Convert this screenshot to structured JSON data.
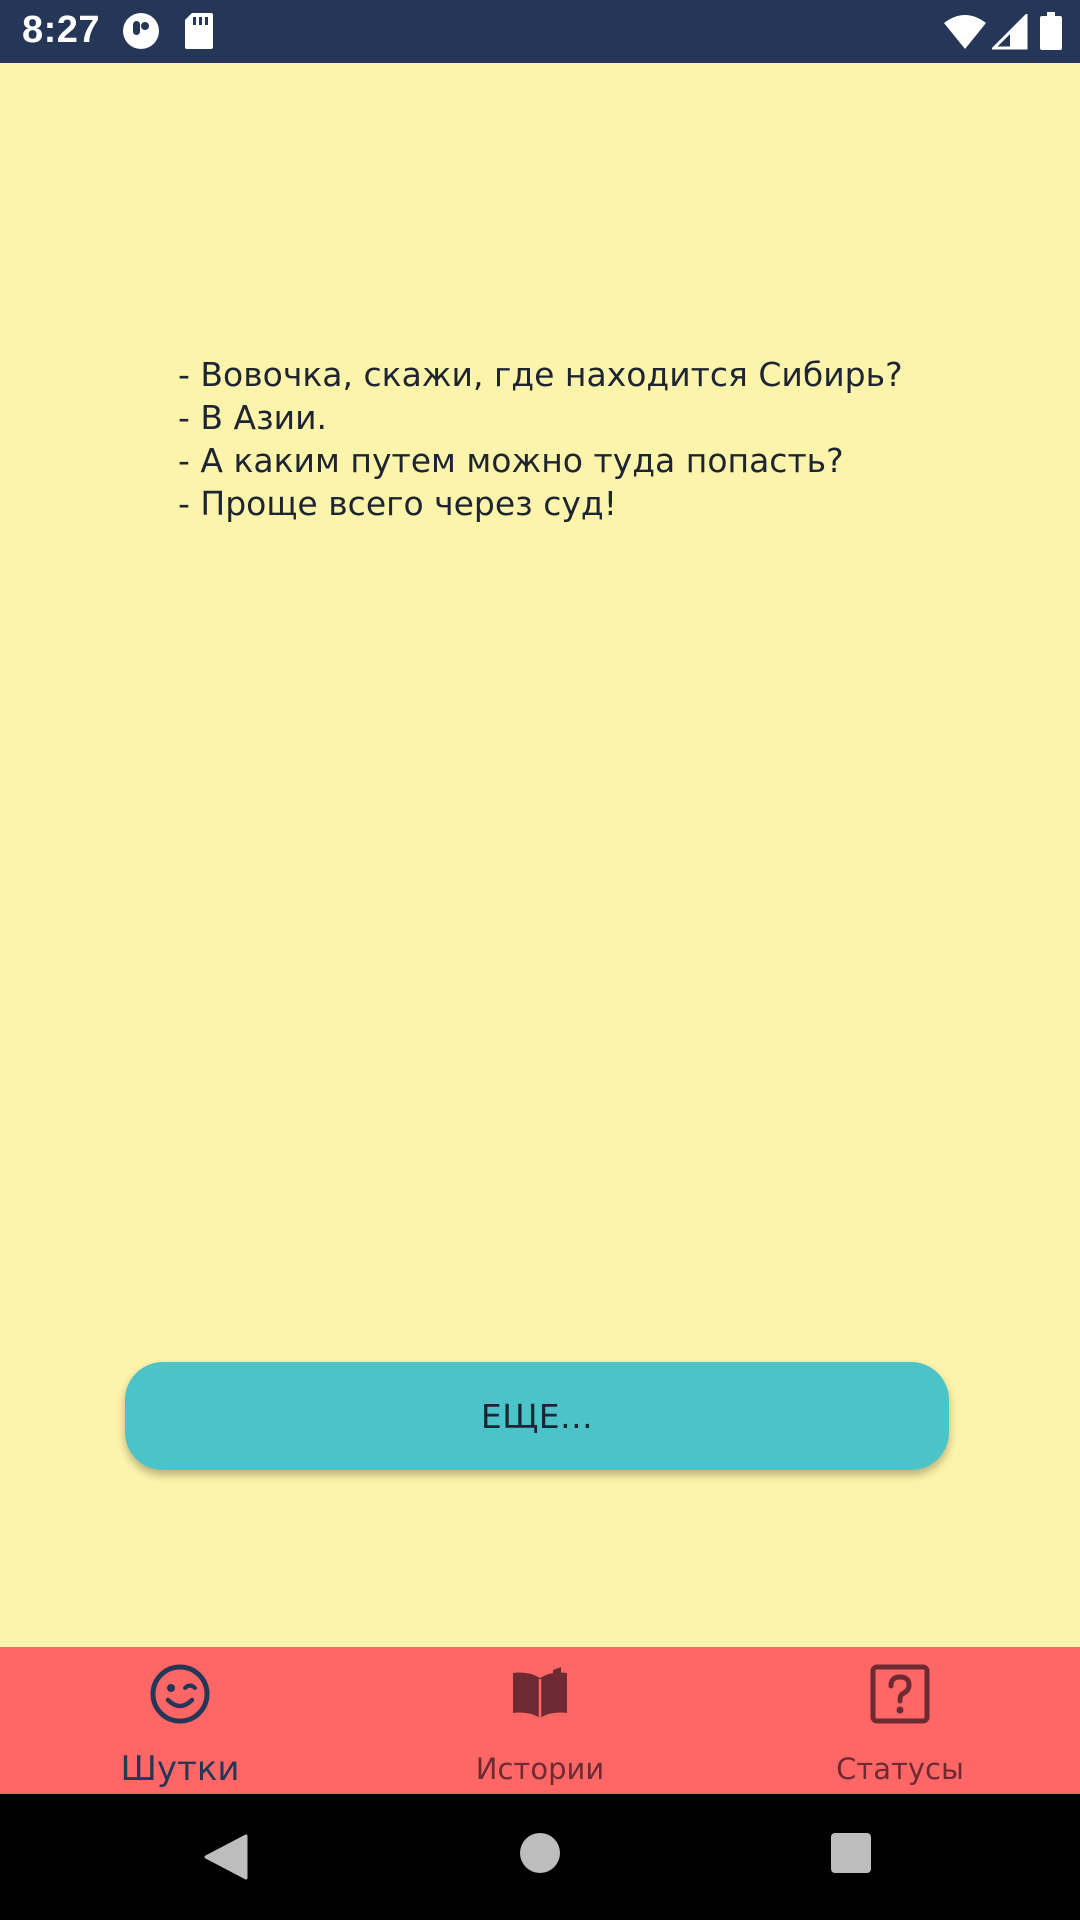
{
  "status_bar": {
    "time": "8:27",
    "left_icons": [
      "app-notification-icon",
      "sd-card-icon"
    ],
    "right_icons": [
      "wifi-icon",
      "cell-signal-icon",
      "battery-icon"
    ]
  },
  "joke": {
    "lines": [
      "- Вовочка, скажи, где находится Сибирь?",
      "- В Азии.",
      "- А каким путем можно туда попасть?",
      "- Проще всего через суд!"
    ]
  },
  "more_button": {
    "label": "ЕЩЕ..."
  },
  "bottom_nav": {
    "items": [
      {
        "label": "Шутки",
        "icon": "wink-smiley-icon",
        "active": true
      },
      {
        "label": "Истории",
        "icon": "open-book-icon",
        "active": false
      },
      {
        "label": "Статусы",
        "icon": "question-box-icon",
        "active": false
      }
    ]
  },
  "colors": {
    "status_bar": "#253656",
    "background": "#FDF4AB",
    "button": "#4BC3C8",
    "bottom_nav": "#FF6766",
    "nav_active": "#253656",
    "nav_inactive": "#6E2A32",
    "system_nav": "#000000"
  }
}
